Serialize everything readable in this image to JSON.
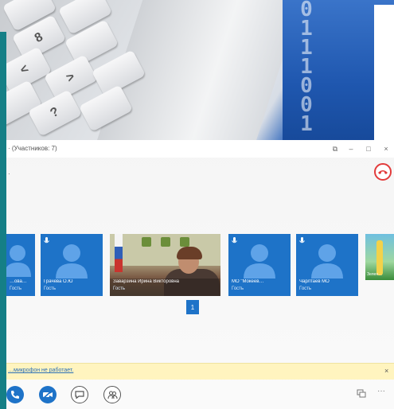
{
  "window": {
    "title": "· (Участников: 7)",
    "sub_label": "·",
    "controls": {
      "restore": "⧉",
      "minimize": "–",
      "maximize": "□",
      "close": "×"
    }
  },
  "photo": {
    "binary_text": "0111001"
  },
  "participants": [
    {
      "name": "…ова…",
      "role": "Гость",
      "type": "avatar"
    },
    {
      "name": "Грачева О.Ю",
      "role": "Гость",
      "type": "avatar"
    },
    {
      "name": "Заварзина Ирина Викторовна",
      "role": "Гость",
      "type": "video"
    },
    {
      "name": "МО \"Мокеев…",
      "role": "Гость",
      "type": "avatar"
    },
    {
      "name": "Чарлтаев МО",
      "role": "Гость",
      "type": "avatar"
    },
    {
      "name": "Зелен…",
      "role": "",
      "type": "partial"
    }
  ],
  "pager": {
    "current": "1"
  },
  "notice": {
    "text": "…микрофон не работает.",
    "close": "×"
  },
  "toolbar": {
    "more": "···"
  },
  "colors": {
    "accent": "#1e73c8",
    "hangup": "#e23b3b",
    "notice_bg": "#fff4bf",
    "teal": "#157f86"
  }
}
